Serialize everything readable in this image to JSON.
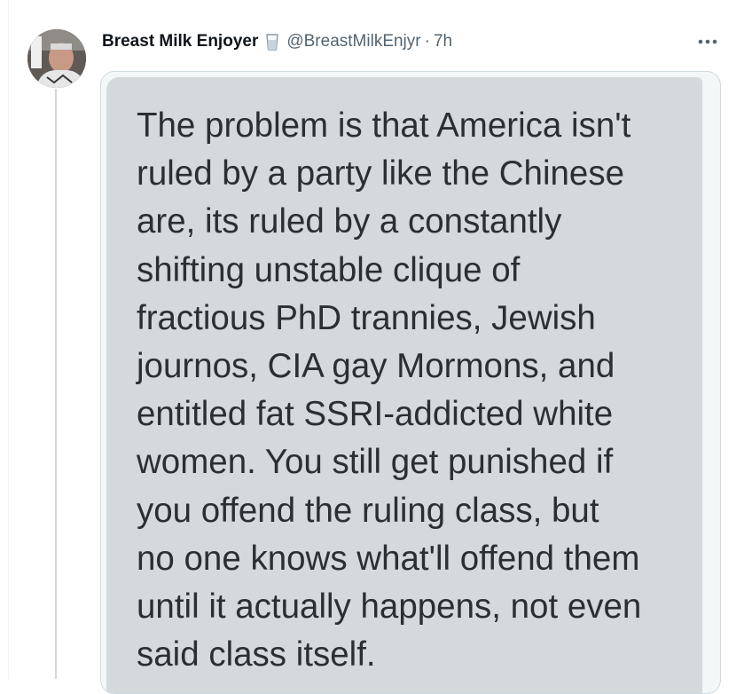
{
  "tweet": {
    "author_name": "Breast Milk Enjoyer",
    "badge_icon": "milk-glass-icon",
    "handle": "@BreastMilkEnjyr",
    "separator": "·",
    "timestamp": "7h",
    "more_icon": "more-horizontal-icon"
  },
  "media": {
    "screenshot_text": "The problem is that America isn't\nruled by a party like the Chinese\nare, its ruled by a constantly\nshifting unstable clique of\nfractious PhD trannies, Jewish\njournos, CIA gay Mormons, and\nentitled fat SSRI-addicted white\nwomen. You still get punished if\nyou offend the ruling class, but\nno one knows what'll offend them\nuntil it actually happens, not even\nsaid class itself."
  },
  "colors": {
    "text_primary": "#0f1419",
    "text_secondary": "#536471",
    "thread_line": "#cfd9de",
    "screenshot_bg": "#d4d9dc",
    "screenshot_text": "#2c2f31"
  }
}
